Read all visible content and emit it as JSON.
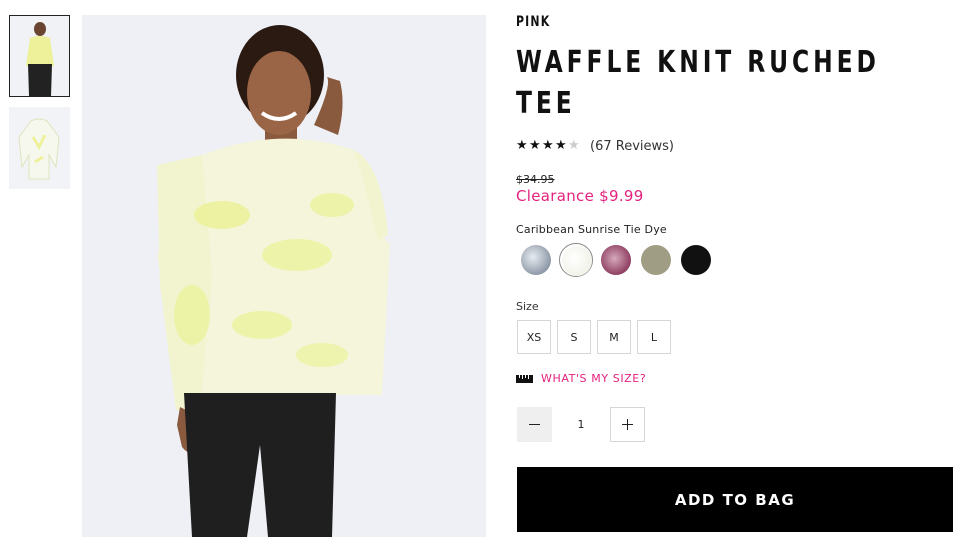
{
  "gallery": {
    "thumbnails": [
      {
        "alt": "model-front-view",
        "active": true
      },
      {
        "alt": "flat-lay-tee",
        "active": false
      }
    ]
  },
  "product": {
    "brand": "PINK",
    "title": "WAFFLE KNIT RUCHED TEE",
    "rating": {
      "stars": 4,
      "max": 5,
      "reviews_text": "(67 Reviews)"
    },
    "original_price": "$34.95",
    "sale_price": "Clearance $9.99",
    "color_name": "Caribbean Sunrise Tie Dye",
    "swatches": [
      {
        "name": "blue-tie-dye-swatch",
        "color": "#aeb7c2",
        "selected": false
      },
      {
        "name": "white-tie-dye-swatch",
        "color": "#f4f6ee",
        "selected": true
      },
      {
        "name": "berry-swatch",
        "color": "#a15a79",
        "selected": false
      },
      {
        "name": "olive-swatch",
        "color": "#9f9d84",
        "selected": false
      },
      {
        "name": "black-swatch",
        "color": "#111111",
        "selected": false
      }
    ],
    "size_label": "Size",
    "sizes": [
      "XS",
      "S",
      "M",
      "L"
    ],
    "size_guide": "WHAT'S MY SIZE?",
    "quantity": "1",
    "add_to_bag": "ADD TO BAG"
  },
  "colors": {
    "accent": "#e3237e",
    "button_bg": "#000000"
  }
}
